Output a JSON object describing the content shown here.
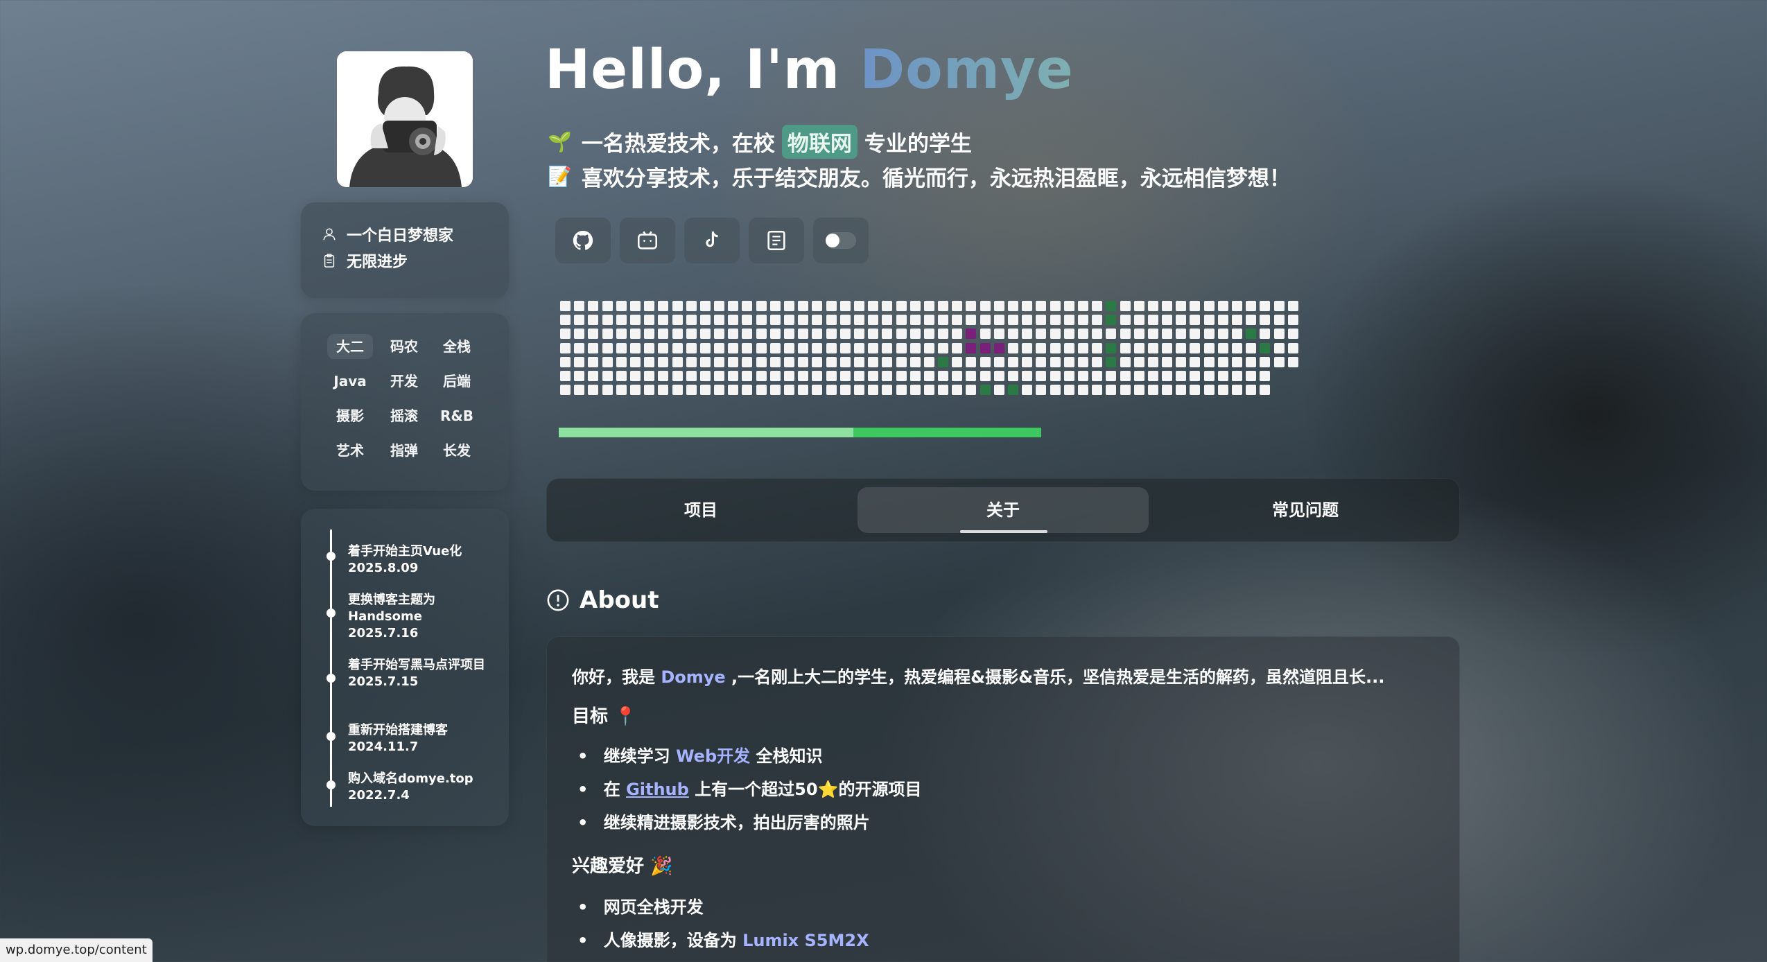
{
  "sidebar": {
    "info": [
      {
        "icon": "user-icon",
        "text": "一个白日梦想家"
      },
      {
        "icon": "clipboard-icon",
        "text": "无限进步"
      }
    ],
    "tags": [
      "大二",
      "码农",
      "全栈",
      "Java",
      "开发",
      "后端",
      "摄影",
      "摇滚",
      "R&B",
      "艺术",
      "指弹",
      "长发"
    ],
    "timeline": [
      {
        "title": "着手开始主页Vue化",
        "date": "2025.8.09"
      },
      {
        "title": "更换博客主题为Handsome",
        "date": "2025.7.16"
      },
      {
        "title": "着手开始写黑马点评项目",
        "date": "2025.7.15"
      },
      {
        "title": "重新开始搭建博客",
        "date": "2024.11.7"
      },
      {
        "title": "购入域名domye.top",
        "date": "2022.7.4"
      }
    ]
  },
  "hero": {
    "greeting": "Hello, I'm ",
    "name": "Domye",
    "line1_emoji": "🌱",
    "line1_pre": "一名热爱技术，在校",
    "line1_highlight": "物联网",
    "line1_post": "专业的学生",
    "line2_emoji": "📝",
    "line2": "喜欢分享技术，乐于结交朋友。循光而行，永远热泪盈眶，永远相信梦想！"
  },
  "social": [
    "github-icon",
    "bilibili-icon",
    "tiktok-icon",
    "blog-icon",
    "theme-toggle"
  ],
  "contrib": {
    "rows": 7,
    "cols": 53,
    "green": [
      [
        39,
        0
      ],
      [
        39,
        1
      ],
      [
        39,
        3
      ],
      [
        39,
        4
      ],
      [
        49,
        2
      ],
      [
        50,
        3
      ],
      [
        27,
        4
      ],
      [
        30,
        6
      ],
      [
        32,
        6
      ]
    ],
    "purple": [
      [
        29,
        2
      ],
      [
        29,
        3
      ],
      [
        30,
        3
      ],
      [
        31,
        3
      ]
    ],
    "empty": [
      [
        51,
        5
      ],
      [
        51,
        6
      ],
      [
        52,
        5
      ],
      [
        52,
        6
      ]
    ]
  },
  "progress": {
    "fraction_light": 0.61,
    "fraction_dark": 0.39
  },
  "tabs": [
    {
      "label": "项目",
      "active": false
    },
    {
      "label": "关于",
      "active": true
    },
    {
      "label": "常见问题",
      "active": false
    }
  ],
  "about": {
    "title": "About",
    "intro_pre": "你好，我是 ",
    "intro_name": "Domye",
    "intro_post": " ,一名刚上大二的学生，热爱编程&摄影&音乐，坚信热爱是生活的解药，虽然道阻且长...",
    "goal_heading": "目标 📍",
    "goals": [
      {
        "pre": "继续学习 ",
        "accent": "Web开发",
        "post": " 全栈知识"
      },
      {
        "pre": "在 ",
        "link": "Github",
        "post": " 上有一个超过50⭐的开源项目"
      },
      {
        "pre": "继续精进摄影技术，拍出厉害的照片"
      }
    ],
    "hobby_heading": "兴趣爱好 🎉",
    "hobbies": [
      {
        "pre": "网页全栈开发"
      },
      {
        "pre": "人像摄影，设备为 ",
        "accent": "Lumix S5M2X"
      }
    ]
  },
  "statusbar": {
    "url": "wp.domye.top/content"
  }
}
